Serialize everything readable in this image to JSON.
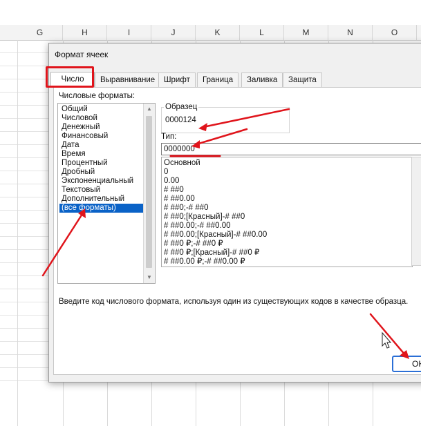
{
  "spreadsheet": {
    "columns": [
      "G",
      "H",
      "I",
      "J",
      "K",
      "L",
      "M",
      "N",
      "O"
    ]
  },
  "dialog": {
    "title": "Формат ячеек",
    "tabs": [
      {
        "label": "Число",
        "active": true
      },
      {
        "label": "Выравнивание",
        "active": false
      },
      {
        "label": "Шрифт",
        "active": false
      },
      {
        "label": "Граница",
        "active": false
      },
      {
        "label": "Заливка",
        "active": false
      },
      {
        "label": "Защита",
        "active": false
      }
    ],
    "categories_label": "Числовые форматы:",
    "categories": [
      "Общий",
      "Числовой",
      "Денежный",
      "Финансовый",
      "Дата",
      "Время",
      "Процентный",
      "Дробный",
      "Экспоненциальный",
      "Текстовый",
      "Дополнительный",
      "(все форматы)"
    ],
    "selected_category": "(все форматы)",
    "sample_label": "Образец",
    "sample_value": "0000124",
    "type_label": "Тип:",
    "type_value": "0000000",
    "type_list": [
      "Основной",
      "0",
      "0.00",
      "# ##0",
      "# ##0.00",
      "# ##0;-# ##0",
      "# ##0;[Красный]-# ##0",
      "# ##0.00;-# ##0.00",
      "# ##0.00;[Красный]-# ##0.00",
      "# ##0 ₽;-# ##0 ₽",
      "# ##0 ₽;[Красный]-# ##0 ₽",
      "# ##0.00 ₽;-# ##0.00 ₽"
    ],
    "hint": "Введите код числового формата, используя один из существующих кодов в качестве образца.",
    "ok_label": "ОК"
  },
  "colors": {
    "annotation": "#e0141b",
    "selection": "#0a62c7",
    "ok_border": "#2b6fd6"
  }
}
